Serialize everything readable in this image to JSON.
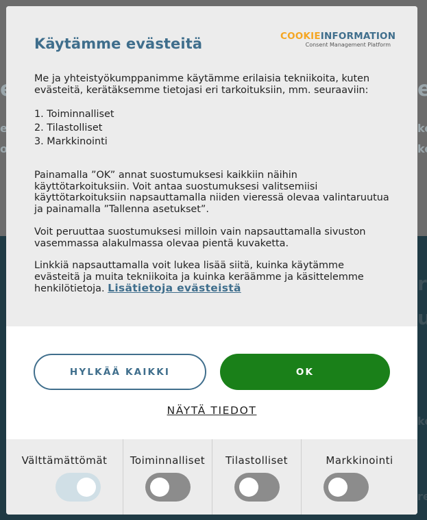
{
  "background": {
    "fragments": [
      "e",
      "ke",
      "u",
      "rc",
      "u",
      "e",
      "o",
      "re"
    ]
  },
  "dialog": {
    "title": "Käytämme evästeitä",
    "brand": {
      "name_part1": "COOKIE",
      "name_part2": "INFORMATION",
      "tagline": "Consent Management Platform"
    },
    "intro": "Me ja yhteistyökumppanimme käytämme erilaisia tekniikoita, kuten evästeitä, kerätäksemme tietojasi eri tarkoituksiin, mm. seuraaviin:",
    "purposes": [
      "1. Toiminnalliset",
      "2. Tilastolliset",
      "3. Markkinointi"
    ],
    "paragraph1": "Painamalla ”OK” annat suostumuksesi kaikkiin näihin käyttötarkoituksiin. Voit antaa suostumuksesi valitsemiisi käyttötarkoituksiin napsauttamalla niiden vieressä olevaa valintaruutua ja painamalla ”Tallenna asetukset”.",
    "paragraph2": "Voit peruuttaa suostumuksesi milloin vain napsauttamalla sivuston vasemmassa alakulmassa olevaa pientä kuvaketta.",
    "paragraph3": "Linkkiä napsauttamalla voit lukea lisää siitä, kuinka käytämme evästeitä ja muita tekniikoita ja kuinka keräämme ja käsittelemme henkilötietoja.",
    "more_link": "Lisätietoja evästeistä",
    "reject_label": "HYLKÄÄ KAIKKI",
    "ok_label": "OK",
    "details_label": "NÄYTÄ TIEDOT",
    "toggles": [
      {
        "label": "Välttämättömät",
        "on": true,
        "disabled": true
      },
      {
        "label": "Toiminnalliset",
        "on": false,
        "disabled": false
      },
      {
        "label": "Tilastolliset",
        "on": false,
        "disabled": false
      },
      {
        "label": "Markkinointi",
        "on": false,
        "disabled": false
      }
    ]
  },
  "colors": {
    "accent": "#3f6e8c",
    "ok_button": "#1a8019",
    "brand_orange": "#f5a623"
  }
}
